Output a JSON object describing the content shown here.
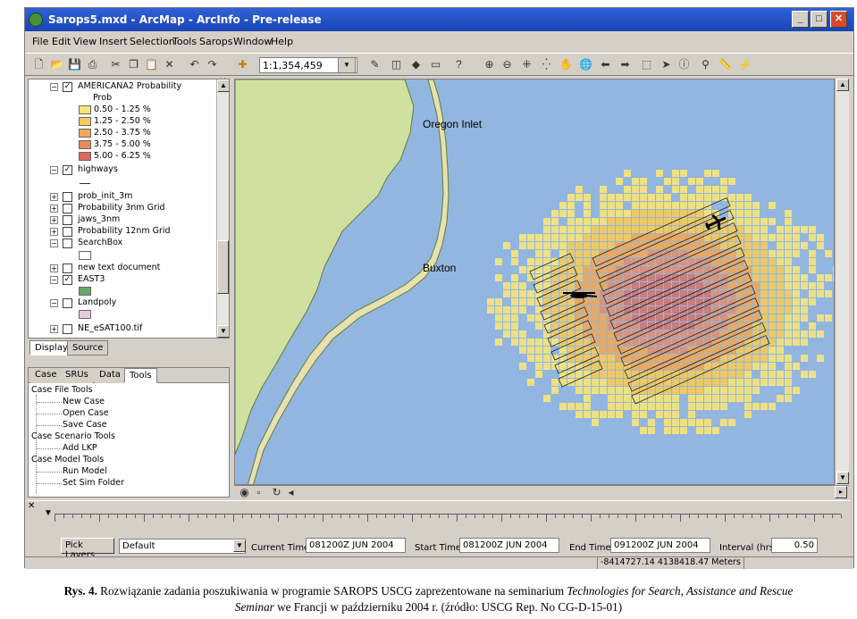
{
  "window": {
    "title": "Sarops5.mxd - ArcMap - ArcInfo - Pre-release",
    "buttons": [
      "_",
      "□",
      "✕"
    ]
  },
  "menu": [
    "File",
    "Edit",
    "View",
    "Insert",
    "Selection",
    "Tools",
    "Sarops",
    "Window",
    "Help"
  ],
  "toolbar": {
    "scale": "1:1,354,459",
    "icons": [
      "new-icon",
      "open-icon",
      "save-icon",
      "print-icon",
      "cut-icon",
      "copy-icon",
      "paste-icon",
      "delete-icon",
      "undo-icon",
      "redo-icon",
      "add-data-icon",
      "zoom-in-icon",
      "zoom-out-icon",
      "fixed-zoom-in-icon",
      "fixed-zoom-out-icon",
      "pan-icon",
      "full-extent-icon",
      "back-icon",
      "forward-icon",
      "select-icon",
      "identify-icon",
      "find-icon",
      "measure-icon",
      "hyperlink-icon"
    ]
  },
  "toc": {
    "layers": [
      {
        "name": "AMERICANA2 Probability",
        "checked": true,
        "expanded": true
      },
      {
        "name": "Prob",
        "is_label": true
      },
      {
        "name": "0.50 - 1.25 %",
        "swatch": "#f7e57a"
      },
      {
        "name": "1.25 - 2.50 %",
        "swatch": "#f5cb5c"
      },
      {
        "name": "2.50 - 3.75 %",
        "swatch": "#f0a85a"
      },
      {
        "name": "3.75 - 5.00 %",
        "swatch": "#e88a62"
      },
      {
        "name": "5.00 - 6.25 %",
        "swatch": "#d96a5e"
      },
      {
        "name": "highways",
        "checked": true,
        "expanded": true
      },
      {
        "name": "prob_init_3m",
        "checked": false
      },
      {
        "name": "Probability 3nm Grid",
        "checked": false
      },
      {
        "name": "jaws_3nm",
        "checked": false
      },
      {
        "name": "Probability 12nm Grid",
        "checked": false
      },
      {
        "name": "SearchBox",
        "checked": false,
        "expanded": true
      },
      {
        "name": "new text document",
        "checked": false
      },
      {
        "name": "EAST3",
        "checked": true,
        "expanded": true
      },
      {
        "name": "Landpoly",
        "checked": false,
        "expanded": true
      },
      {
        "name": "NE_eSAT100.tif",
        "checked": false
      }
    ],
    "tabs": [
      "Display",
      "Source"
    ]
  },
  "tools": {
    "tabs": [
      "Case",
      "SRUs",
      "Data",
      "Tools"
    ],
    "tree": [
      {
        "label": "Case File Tools",
        "level": 0
      },
      {
        "label": "New Case",
        "level": 1
      },
      {
        "label": "Open Case",
        "level": 1
      },
      {
        "label": "Save Case",
        "level": 1
      },
      {
        "label": "Case Scenario Tools",
        "level": 0
      },
      {
        "label": "Add LKP",
        "level": 1
      },
      {
        "label": "Case Model Tools",
        "level": 0
      },
      {
        "label": "Run Model",
        "level": 1
      },
      {
        "label": "Set Sim Folder",
        "level": 1
      }
    ]
  },
  "map": {
    "labels": {
      "oregon": "Oregon Inlet",
      "buxton": "Buxton"
    },
    "colors": {
      "sea": "#93b6e0",
      "land": "#cfe0a0"
    }
  },
  "bottom": {
    "pick_layers": "Pick Layers",
    "layer_default": "Default",
    "current_time_label": "Current Time",
    "current_time": "081200Z JUN 2004",
    "start_time_label": "Start Time",
    "start_time": "081200Z JUN 2004",
    "end_time_label": "End Time",
    "end_time": "091200Z JUN 2004",
    "interval_label": "Interval (hrs)",
    "interval": "0.50"
  },
  "status": {
    "coordinates": "-8414727.14  4138418.47 Meters"
  },
  "caption": {
    "prefix": "Rys. 4.",
    "text1": "Rozwiązanie zadania poszukiwania w programie SAROPS USCG zaprezentowane na seminarium",
    "italic1": "Technologies for Search, Assistance and Rescue",
    "italic2": "Seminar",
    "text2": "we Francji w październiku 2004 r. (źródło: USCG Rep. No CG-D-15-01)"
  }
}
